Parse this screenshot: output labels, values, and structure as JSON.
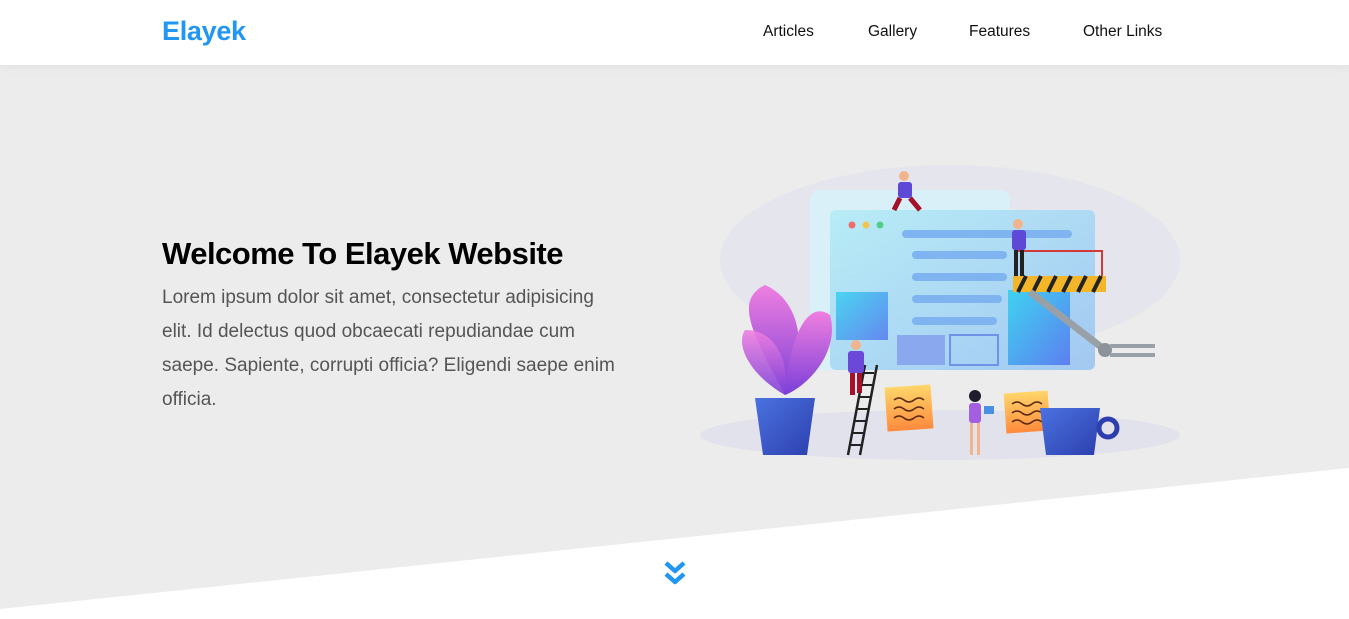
{
  "header": {
    "logo": "Elayek",
    "nav": [
      {
        "label": "Articles"
      },
      {
        "label": "Gallery"
      },
      {
        "label": "Features"
      },
      {
        "label": "Other Links"
      }
    ]
  },
  "hero": {
    "title": "Welcome To Elayek Website",
    "text": "Lorem ipsum dolor sit amet, consectetur adipisicing elit. Id delectus quod obcaecati repudiandae cum saepe. Sapiente, corrupti officia? Eligendi saepe enim officia.",
    "illustration_icon": "website-building-illustration"
  },
  "scroll_icon": "double-chevron-down-icon",
  "colors": {
    "accent": "#2196f3",
    "landing_bg": "#ececec",
    "header_bg": "#ffffff",
    "title": "#000000",
    "body_text": "#555555"
  }
}
